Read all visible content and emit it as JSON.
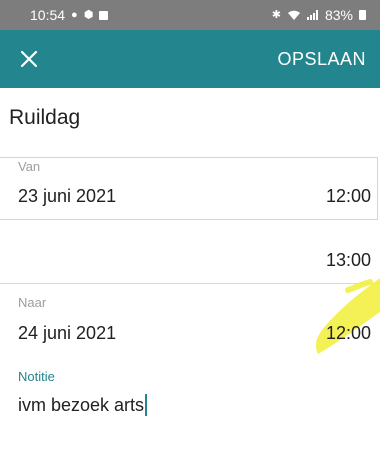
{
  "status_bar": {
    "time": "10:54",
    "battery": "83%"
  },
  "toolbar": {
    "close_icon": "close-icon",
    "save_label": "OPSLAAN"
  },
  "form": {
    "type": "Ruildag",
    "van": {
      "label": "Van",
      "date": "23 juni 2021",
      "time": "12:00"
    },
    "between_time": "13:00",
    "naar": {
      "label": "Naar",
      "date": "24 juni 2021",
      "time": "12:00"
    },
    "notitie": {
      "label": "Notitie",
      "value": "ivm bezoek arts"
    }
  },
  "colors": {
    "accent": "#23858d",
    "status_bar": "#7d7d7d",
    "highlight": "#f2ef3a"
  }
}
